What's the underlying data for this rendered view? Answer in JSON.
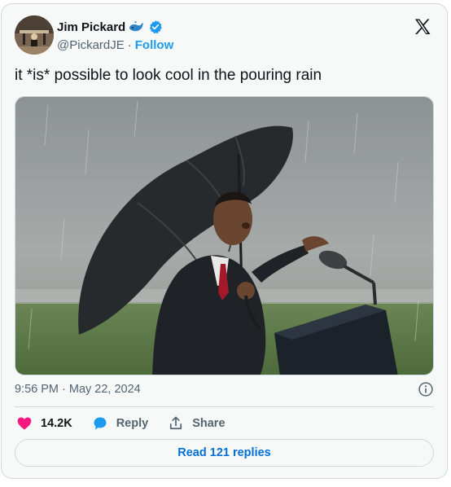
{
  "author": {
    "name": "Jim Pickard",
    "handle": "@PickardJE",
    "separator": "·",
    "follow_label": "Follow",
    "avatar": "avatar-photo",
    "badges": [
      "whale-emoji-icon",
      "verified-badge-icon"
    ]
  },
  "platform_logo": "x-logo-icon",
  "tweet": {
    "text": "it *is* possible to look cool in the pouring rain",
    "media": "photo-man-with-umbrella-speaking-at-podium-in-rain"
  },
  "timestamp": "9:56 PM · May 22, 2024",
  "actions": {
    "likes": "14.2K",
    "reply_label": "Reply",
    "share_label": "Share"
  },
  "read_replies_label": "Read 121 replies",
  "colors": {
    "accent": "#1d9bf0",
    "link": "#006fd6",
    "like": "#f91880",
    "reply_bubble": "#1d9bf0",
    "secondary_text": "#536471"
  }
}
